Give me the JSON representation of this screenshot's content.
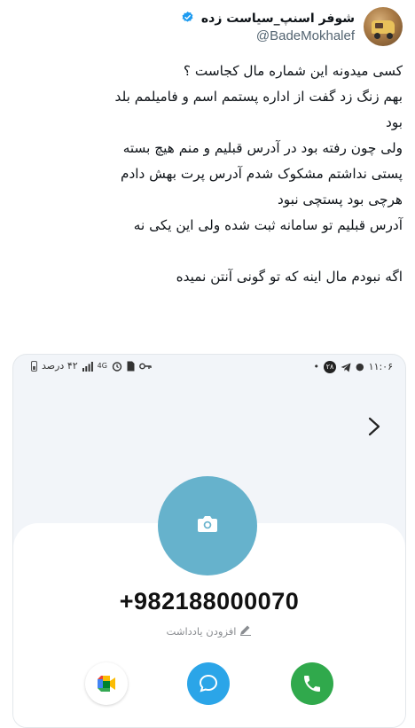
{
  "tweet": {
    "author": {
      "display_name": "شوفر اسنپ_سیاست زده",
      "handle": "@BadeMokhalef",
      "verified": true
    },
    "text_lines": [
      "کسی میدونه این شماره مال کجاست ؟",
      "بهم زنگ زد گفت از اداره پستمم اسم و فامیلمم بلد",
      "بود",
      "ولی چون رفته بود در آدرس قبلیم و منم هیچ بسته",
      "پستی نداشتم مشکوک شدم آدرس پرت بهش دادم",
      "هرچی بود پستچی نبود",
      "آدرس قبلیم تو سامانه ثبت شده ولی این یکی نه",
      "",
      "اگه نبودم مال اینه که تو گونی آنتن نمیده"
    ]
  },
  "phone_screenshot": {
    "status_bar": {
      "time": "۱۱:۰۶",
      "notification_badge": "۲۸",
      "battery_text": "۴۲ درصد",
      "network": "4G"
    },
    "contact": {
      "phone_number": "+982188000070",
      "add_note_label": "افزودن یادداشت"
    },
    "actions": [
      {
        "name": "video-call",
        "icon": "google-meet-icon"
      },
      {
        "name": "message",
        "icon": "chat-bubble-icon"
      },
      {
        "name": "call",
        "icon": "phone-icon"
      }
    ],
    "colors": {
      "contact_photo": "#66b2cc",
      "message_button": "#2ba5e8",
      "call_button": "#30a94c"
    }
  }
}
